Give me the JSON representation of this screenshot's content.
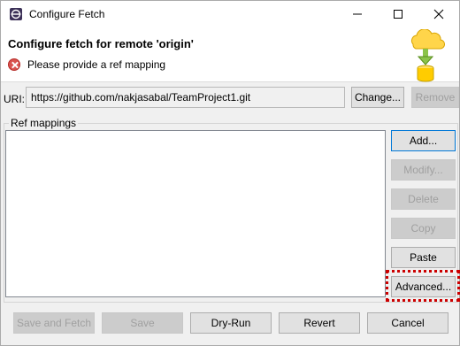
{
  "window": {
    "title": "Configure Fetch",
    "controls": [
      "minimize-icon",
      "maximize-icon",
      "close-icon"
    ]
  },
  "header": {
    "title": "Configure fetch for remote 'origin'",
    "error_icon": "error-icon",
    "message": "Please provide a ref mapping",
    "graphic": "cloud-to-database-icon"
  },
  "uri": {
    "label": "URI:",
    "value": "https://github.com/nakjasabal/TeamProject1.git",
    "change_label": "Change...",
    "remove_label": "Remove"
  },
  "ref_mappings": {
    "label": "Ref mappings",
    "items": [],
    "buttons": {
      "add": "Add...",
      "modify": "Modify...",
      "delete": "Delete",
      "copy": "Copy",
      "paste": "Paste",
      "advanced": "Advanced..."
    }
  },
  "footer": {
    "save_and_fetch": "Save and Fetch",
    "save": "Save",
    "dry_run": "Dry-Run",
    "revert": "Revert",
    "cancel": "Cancel"
  },
  "colors": {
    "window_bg": "#f0f0f0",
    "header_bg": "#ffffff",
    "focus_border": "#0078d7",
    "highlight": "#cc0000",
    "error": "#d9534f"
  }
}
